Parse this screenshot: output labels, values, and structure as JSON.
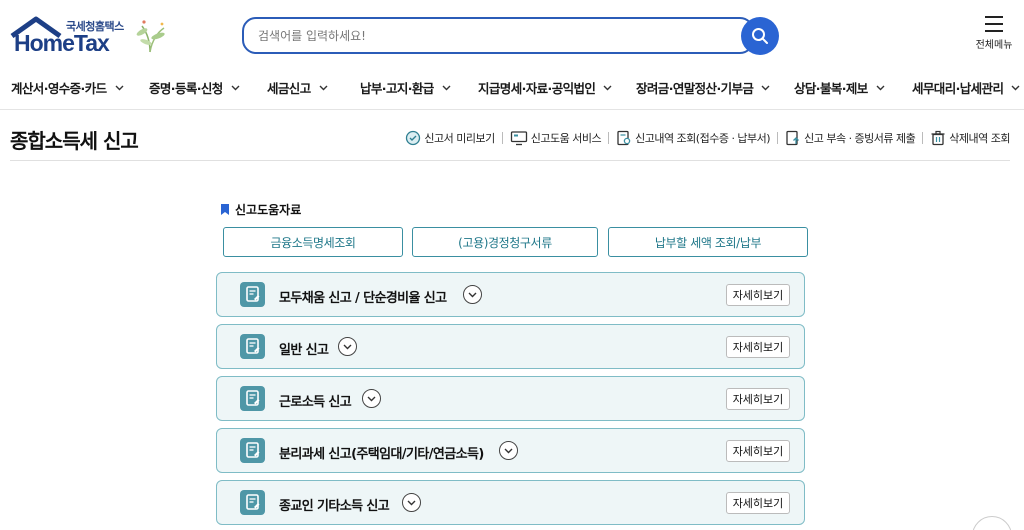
{
  "header": {
    "logo_sub": "국세청홈택스",
    "logo_main": "HomeTax",
    "search_placeholder": "검색어를 입력하세요!",
    "menu_all_label": "전체메뉴"
  },
  "nav": {
    "items": [
      {
        "label": "계산서·영수증·카드"
      },
      {
        "label": "증명·등록·신청"
      },
      {
        "label": "세금신고"
      },
      {
        "label": "납부·고지·환급"
      },
      {
        "label": "지급명세·자료·공익법인"
      },
      {
        "label": "장려금·연말정산·기부금"
      },
      {
        "label": "상담·불복·제보"
      },
      {
        "label": "세무대리·납세관리"
      }
    ]
  },
  "page": {
    "title": "종합소득세 신고",
    "quick_links": [
      {
        "label": "신고서 미리보기",
        "icon": "preview-icon"
      },
      {
        "label": "신고도움 서비스",
        "icon": "monitor-icon"
      },
      {
        "label": "신고내역 조회(접수증 · 납부서)",
        "icon": "document-search-icon"
      },
      {
        "label": "신고 부속 · 증빙서류 제출",
        "icon": "upload-document-icon"
      },
      {
        "label": "삭제내역 조회",
        "icon": "trash-icon"
      }
    ]
  },
  "help": {
    "title": "신고도움자료",
    "buttons": [
      {
        "label": "금융소득명세조회"
      },
      {
        "label": "(고용)경정청구서류"
      },
      {
        "label": "납부할 세액 조회/납부"
      }
    ]
  },
  "cards": [
    {
      "title": "모두채움 신고 / 단순경비율 신고",
      "detail_label": "자세히보기"
    },
    {
      "title": "일반 신고",
      "detail_label": "자세히보기"
    },
    {
      "title": "근로소득 신고",
      "detail_label": "자세히보기"
    },
    {
      "title": "분리과세 신고(주택임대/기타/연금소득)",
      "detail_label": "자세히보기"
    },
    {
      "title": "종교인 기타소득 신고",
      "detail_label": "자세히보기"
    }
  ],
  "colors": {
    "brand_blue": "#1d3f86",
    "search_blue": "#2a64d3",
    "teal": "#3a8fa1",
    "card_bg": "#eef6f7"
  }
}
